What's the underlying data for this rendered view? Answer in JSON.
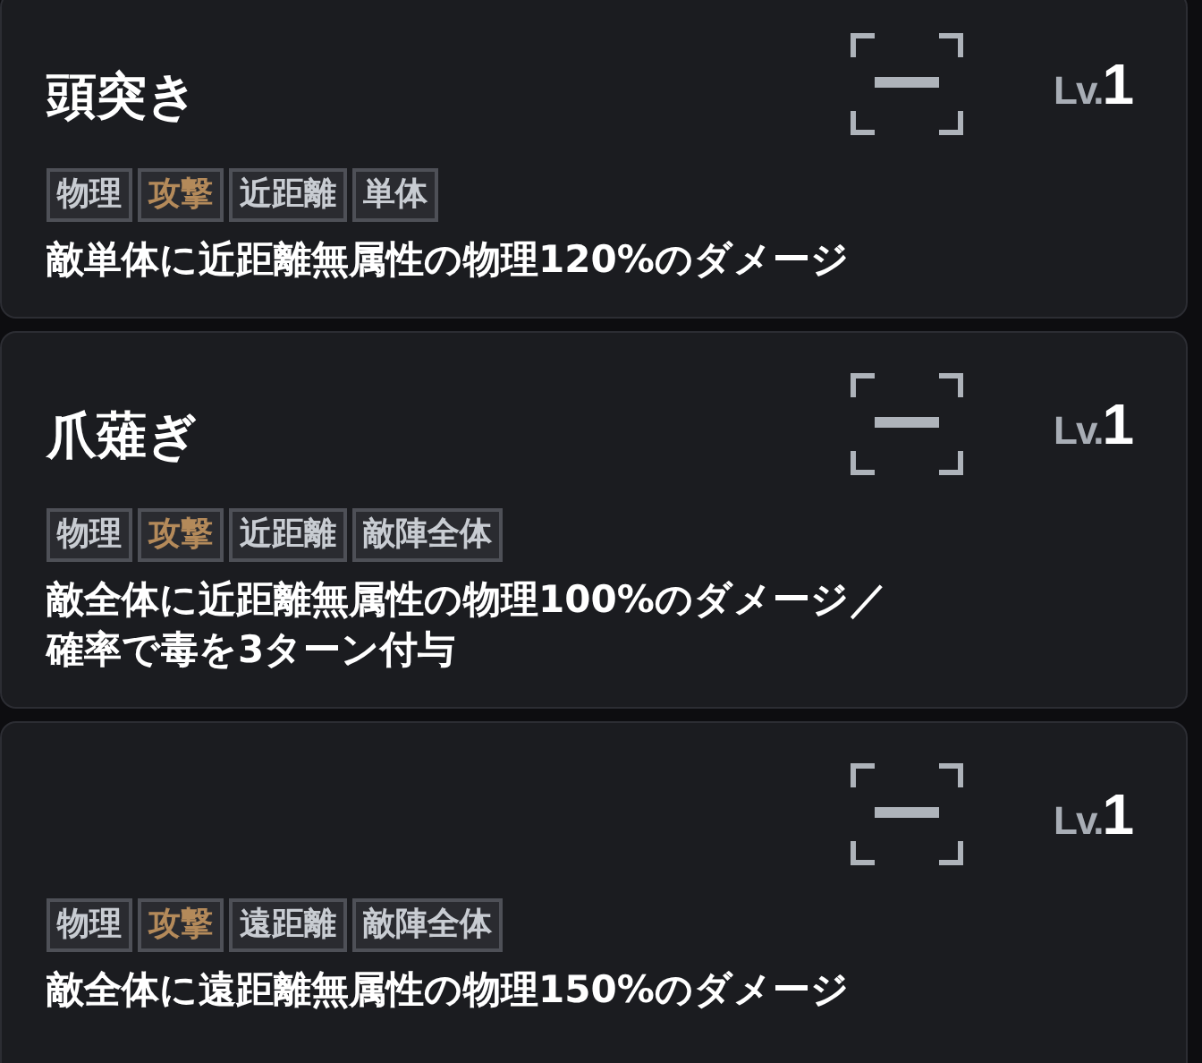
{
  "skills": [
    {
      "name": "頭突き",
      "level_prefix": "Lv.",
      "level_value": "1",
      "tags": [
        {
          "label": "物理",
          "kind": "normal"
        },
        {
          "label": "攻撃",
          "kind": "attack"
        },
        {
          "label": "近距離",
          "kind": "normal"
        },
        {
          "label": "単体",
          "kind": "normal"
        }
      ],
      "description": [
        "敵単体に近距離無属性の物理120%のダメージ"
      ]
    },
    {
      "name": "爪薙ぎ",
      "level_prefix": "Lv.",
      "level_value": "1",
      "tags": [
        {
          "label": "物理",
          "kind": "normal"
        },
        {
          "label": "攻撃",
          "kind": "attack"
        },
        {
          "label": "近距離",
          "kind": "normal"
        },
        {
          "label": "敵陣全体",
          "kind": "normal"
        }
      ],
      "description": [
        "敵全体に近距離無属性の物理100%のダメージ／",
        "確率で毒を3ターン付与"
      ]
    },
    {
      "level_prefix": "Lv.",
      "level_value": "1",
      "tags": [
        {
          "label": "物理",
          "kind": "normal"
        },
        {
          "label": "攻撃",
          "kind": "attack"
        },
        {
          "label": "遠距離",
          "kind": "normal"
        },
        {
          "label": "敵陣全体",
          "kind": "normal"
        }
      ],
      "description": [
        "敵全体に遠距離無属性の物理150%のダメージ"
      ]
    }
  ]
}
